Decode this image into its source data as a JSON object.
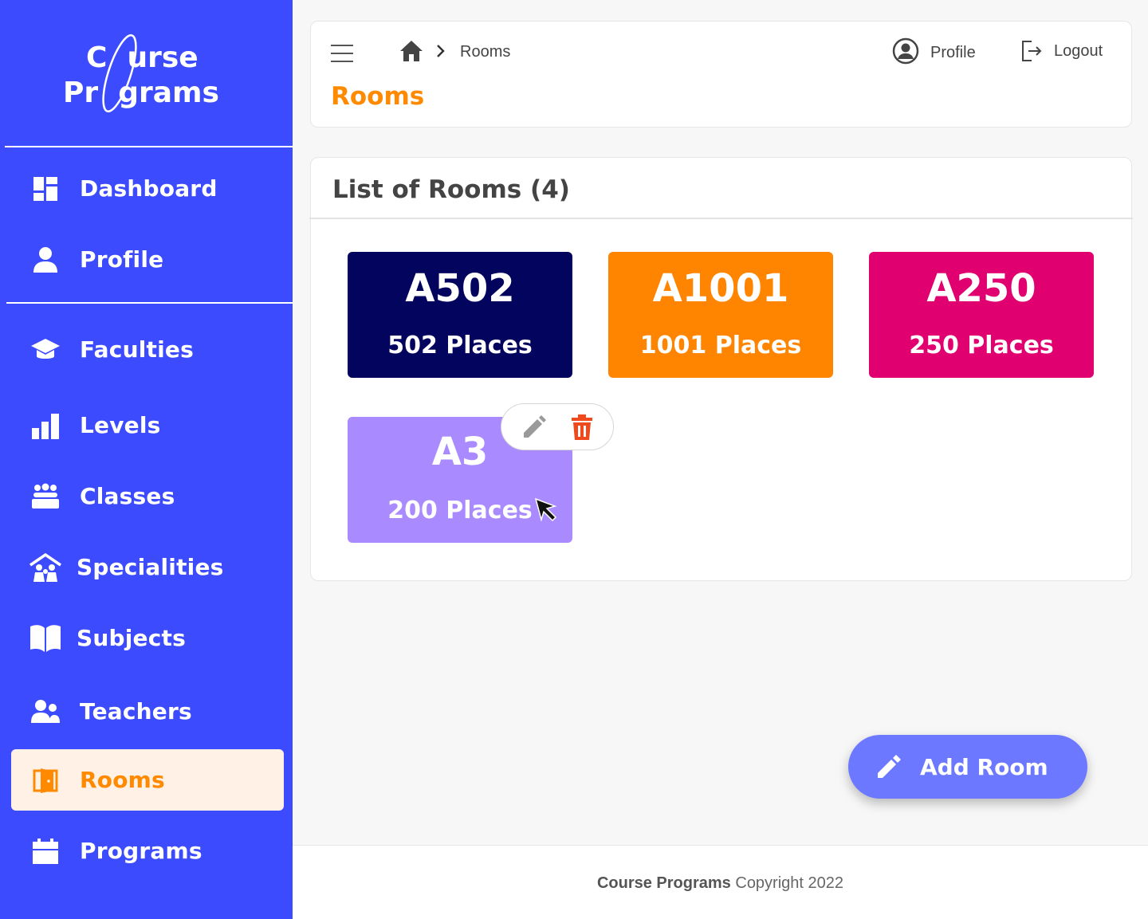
{
  "app": {
    "logo_line1": "C  urse",
    "logo_line2": "Pr  grams"
  },
  "sidebar": {
    "items": [
      {
        "label": "Dashboard",
        "icon": "dashboard-icon"
      },
      {
        "label": "Profile",
        "icon": "user-icon"
      },
      {
        "label": "Faculties",
        "icon": "graduation-cap-icon"
      },
      {
        "label": "Levels",
        "icon": "bar-chart-icon"
      },
      {
        "label": "Classes",
        "icon": "group-icon"
      },
      {
        "label": "Specialities",
        "icon": "family-house-icon"
      },
      {
        "label": "Subjects",
        "icon": "book-icon"
      },
      {
        "label": "Teachers",
        "icon": "users-icon"
      },
      {
        "label": "Rooms",
        "icon": "door-icon",
        "active": true
      },
      {
        "label": "Programs",
        "icon": "calendar-icon"
      }
    ]
  },
  "header": {
    "breadcrumb_current": "Rooms",
    "title": "Rooms",
    "profile_label": "Profile",
    "logout_label": "Logout"
  },
  "rooms": {
    "title": "List of Rooms (4)",
    "list": [
      {
        "name": "A502",
        "places": "502 Places",
        "color": "#02045e"
      },
      {
        "name": "A1001",
        "places": "1001 Places",
        "color": "#ff8500"
      },
      {
        "name": "A250",
        "places": "250 Places",
        "color": "#e0006f"
      },
      {
        "name": "A3",
        "places": "200 Places",
        "color": "#a98aff"
      }
    ]
  },
  "fab": {
    "label": "Add Room"
  },
  "footer": {
    "brand": "Course Programs",
    "text": " Copyright 2022"
  },
  "colors": {
    "sidebar": "#3d4bff",
    "accent": "#ff8a00",
    "fab": "#6b78ff",
    "delete": "#f04a1c"
  }
}
